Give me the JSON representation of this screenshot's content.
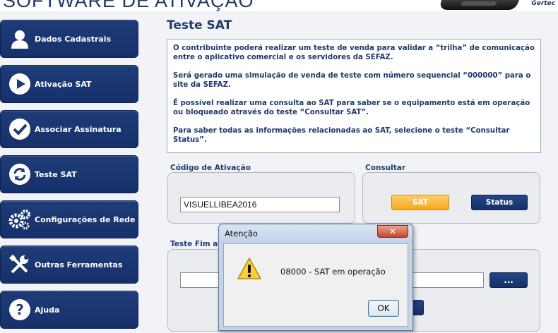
{
  "app": {
    "title": "SOFTWARE DE ATIVAÇÃO",
    "brand": "Gertec"
  },
  "sidebar": {
    "items": [
      {
        "label": "Dados Cadastrais",
        "icon": "user-icon"
      },
      {
        "label": "Ativação SAT",
        "icon": "play-icon"
      },
      {
        "label": "Associar Assinatura",
        "icon": "check-icon"
      },
      {
        "label": "Teste SAT",
        "icon": "refresh-icon"
      },
      {
        "label": "Configurações de Rede",
        "icon": "gears-icon"
      },
      {
        "label": "Outras Ferramentas",
        "icon": "tools-icon"
      },
      {
        "label": "Ajuda",
        "icon": "help-icon"
      }
    ]
  },
  "main": {
    "title": "Teste SAT",
    "info": [
      "O contribuinte poderá realizar um teste de venda para validar a “trilha” de comunicação entre o aplicativo comercial e os servidores da SEFAZ.",
      "Será gerado uma simulação de venda de teste com número sequencial “000000” para o site da SEFAZ.",
      "É possível realizar uma consulta ao SAT para saber se o equipamento está em operação ou bloqueado através do teste “Consultar SAT”.",
      "Para saber todas as informações relacionadas ao SAT, selecione o teste “Consultar Status”."
    ],
    "activation": {
      "label": "Código de Ativação",
      "value": "VISUELLIBEA2016"
    },
    "consult": {
      "label": "Consultar",
      "sat_button": "SAT",
      "status_button": "Status"
    },
    "end_to_end": {
      "label": "Teste Fim a",
      "browse_button": "..."
    }
  },
  "dialog": {
    "title": "Atenção",
    "close_label": "✕",
    "message": "08000 - SAT em operação",
    "ok_label": "OK",
    "icon": "warning-icon"
  },
  "colors": {
    "navy": "#1f3c78",
    "title_text": "#1f3a6b",
    "sat_orange": "#f3a91f",
    "background": "#f2f3f7"
  }
}
